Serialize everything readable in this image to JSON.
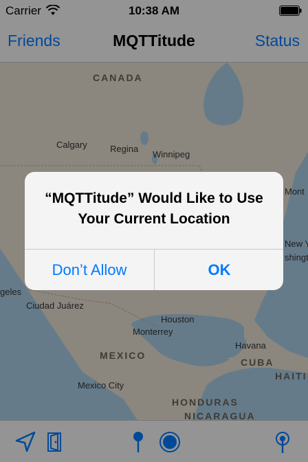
{
  "status_bar": {
    "carrier": "Carrier",
    "time": "10:38 AM"
  },
  "nav": {
    "left_button": "Friends",
    "title": "MQTTitude",
    "right_button": "Status"
  },
  "map": {
    "labels": {
      "canada": "CANADA",
      "calgary": "Calgary",
      "regina": "Regina",
      "winnipeg": "Winnipeg",
      "mont": "Mont",
      "new_york": "New Y",
      "washington": "shingt",
      "angeles": "geles",
      "ciudad_juarez": "Ciudad Juárez",
      "houston": "Houston",
      "monterrey": "Monterrey",
      "mexico": "MEXICO",
      "havana": "Havana",
      "cuba": "CUBA",
      "haiti": "HAITI",
      "mexico_city": "Mexico City",
      "honduras": "HONDURAS",
      "nicaragua": "NICARAGUA"
    }
  },
  "alert": {
    "title": "“MQTTitude” Would Like to Use Your Current Location",
    "cancel_label": "Don’t Allow",
    "ok_label": "OK"
  },
  "toolbar": {
    "items": [
      "location-arrow-icon",
      "door-icon",
      "pin-icon",
      "record-icon",
      "antenna-icon"
    ]
  },
  "colors": {
    "accent": "#007aff",
    "land": "#e7e2d4",
    "water": "#a9cde6"
  }
}
